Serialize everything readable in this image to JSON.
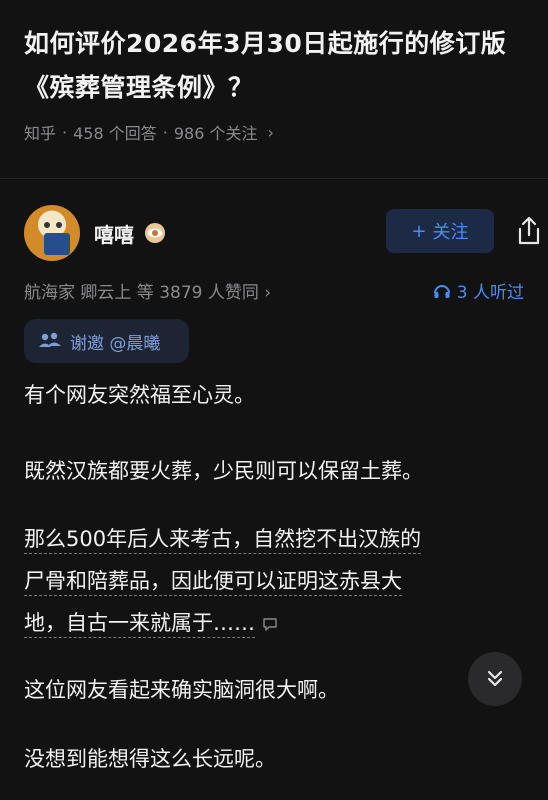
{
  "question": {
    "title": "如何评价2026年3月30日起施行的修订版《殡葬管理条例》？",
    "source": "知乎",
    "answers": "458 个回答",
    "followers": "986 个关注",
    "separator": "·",
    "chevron": "›"
  },
  "author": {
    "name": "嘻嘻",
    "follow_label": "关注",
    "follow_prefix": "+",
    "avatar_icon": "cartoon-avatar",
    "badge_icon": "eye-badge-icon",
    "share_icon": "share-icon"
  },
  "endorse": {
    "text": "航海家 卿云上 等 3879 人赞同 ›"
  },
  "listeners": {
    "text": "3 人听过",
    "icon": "headphones-icon"
  },
  "invite": {
    "text": "谢邀 @晨曦",
    "icon": "group-icon"
  },
  "answer": {
    "paragraphs": [
      "有个网友突然福至心灵。",
      "既然汉族都要火葬，少民则可以保留土葬。",
      "那么500年后人来考古，自然挖不出汉族的尸骨和陪葬品，因此便可以证明这赤县大地，自古一来就属于……",
      "这位网友看起来确实脑洞很大啊。",
      "没想到能想得这么长远呢。"
    ],
    "p3_lines": [
      "那么500年后人来考古，自然挖不出汉族的",
      "尸骨和陪葬品，因此便可以证明这赤县大",
      "地，自古一来就属于……"
    ]
  },
  "colors": {
    "background": "#121212",
    "accent": "#4a8cf7",
    "muted": "#8a8a8f"
  }
}
